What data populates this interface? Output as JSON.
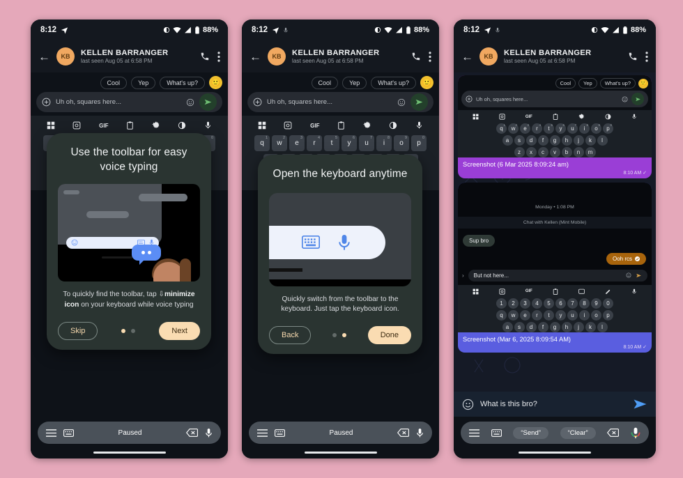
{
  "page": {
    "background_color": "#e5a8ba"
  },
  "status_bar": {
    "time": "8:12",
    "battery": "88%",
    "icons": [
      "navigation-arrow-icon",
      "wifi-icon",
      "signal-icon",
      "battery-icon",
      "dnd-icon"
    ]
  },
  "app_header": {
    "avatar_initials": "KB",
    "contact_name": "KELLEN BARRANGER",
    "subtitle": "last seen Aug 05 at 6:58 PM",
    "icons": [
      "back-arrow-icon",
      "call-icon",
      "overflow-menu-icon"
    ]
  },
  "chat": {
    "smart_replies": [
      "Cool",
      "Yep",
      "What's up?"
    ],
    "emoji_chip": "🙂",
    "compose_placeholder": "Uh oh, squares here...",
    "compose_icons": [
      "plus-circle-icon",
      "emoji-icon",
      "rcs-send-icon"
    ]
  },
  "keyboard": {
    "toolbar_icons": [
      "grid-icon",
      "sticker-icon",
      "gif-icon",
      "clipboard-icon",
      "settings-icon",
      "theme-icon",
      "mic-icon"
    ],
    "row1": [
      {
        "k": "q",
        "n": "1"
      },
      {
        "k": "w",
        "n": "2"
      },
      {
        "k": "e",
        "n": "3"
      },
      {
        "k": "r",
        "n": "4"
      },
      {
        "k": "t",
        "n": "5"
      },
      {
        "k": "y",
        "n": "6"
      },
      {
        "k": "u",
        "n": "7"
      },
      {
        "k": "i",
        "n": "8"
      },
      {
        "k": "o",
        "n": "9"
      },
      {
        "k": "p",
        "n": "0"
      }
    ],
    "row2": [
      "a",
      "s",
      "d",
      "f",
      "g",
      "h",
      "j",
      "k",
      "l"
    ],
    "row3": [
      "z",
      "x",
      "c",
      "v",
      "b",
      "n",
      "m"
    ]
  },
  "voice_toolbar": {
    "status": "Paused",
    "icons": [
      "menu-icon",
      "keyboard-icon",
      "backspace-icon",
      "mic-icon"
    ]
  },
  "dialogs": [
    {
      "id": "dialog-voice-typing",
      "title": "Use the toolbar for easy voice typing",
      "body_prefix": "To quickly find the toolbar, tap ",
      "body_bold": "minimize icon",
      "body_suffix": " on your keyboard while voice typing",
      "left_button": "Skip",
      "right_button": "Next",
      "dots_active_index": 0,
      "dots_count": 2
    },
    {
      "id": "dialog-open-keyboard",
      "title": "Open the keyboard anytime",
      "body": "Quickly switch from the toolbar to the keyboard. Just tap the keyboard icon.",
      "left_button": "Back",
      "right_button": "Done",
      "dots_active_index": 1,
      "dots_count": 2
    }
  ],
  "phone3": {
    "screenshot_messages": [
      {
        "caption": "Screenshot (6 Mar 2025 8:09:24 am)",
        "time": "8:10 AM",
        "bubble_color": "#9a3ed6",
        "status_icon": "delivered-check-icon"
      },
      {
        "caption": "Screenshot (Mar 6, 2025 8:09:54 AM)",
        "time": "8:10 AM",
        "bubble_color": "#5a5ee0",
        "status_icon": "delivered-check-icon"
      }
    ],
    "inner_chat": {
      "day_divider": "Monday • 1:08 PM",
      "system_note": "Chat with Kellen (Mint Mobile)",
      "incoming_message": "Sup bro",
      "outgoing_message": "Ooh rcs",
      "draft_text": "But not here...",
      "keyboard_numbers": [
        "1",
        "2",
        "3",
        "4",
        "5",
        "6",
        "7",
        "8",
        "9",
        "0"
      ],
      "keyboard_row1": [
        "q",
        "w",
        "e",
        "r",
        "t",
        "y",
        "u",
        "i",
        "o",
        "p"
      ],
      "keyboard_row2": [
        "a",
        "s",
        "d",
        "f",
        "g",
        "h",
        "j",
        "k",
        "l"
      ]
    },
    "compose_value": "What is this bro?",
    "voice_toolbar_commands": [
      "“Send”",
      "“Clear”"
    ],
    "voice_toolbar_icons": [
      "menu-icon",
      "keyboard-icon",
      "backspace-icon",
      "google-mic-icon"
    ],
    "send_icon": "send-icon",
    "emoji_icon": "emoji-icon"
  },
  "colors": {
    "accent_peach": "#fadcb2",
    "avatar_orange": "#f0a860",
    "dialog_bg": "#2a3431",
    "bubble_purple": "#9a3ed6",
    "bubble_blue": "#5a5ee0"
  }
}
